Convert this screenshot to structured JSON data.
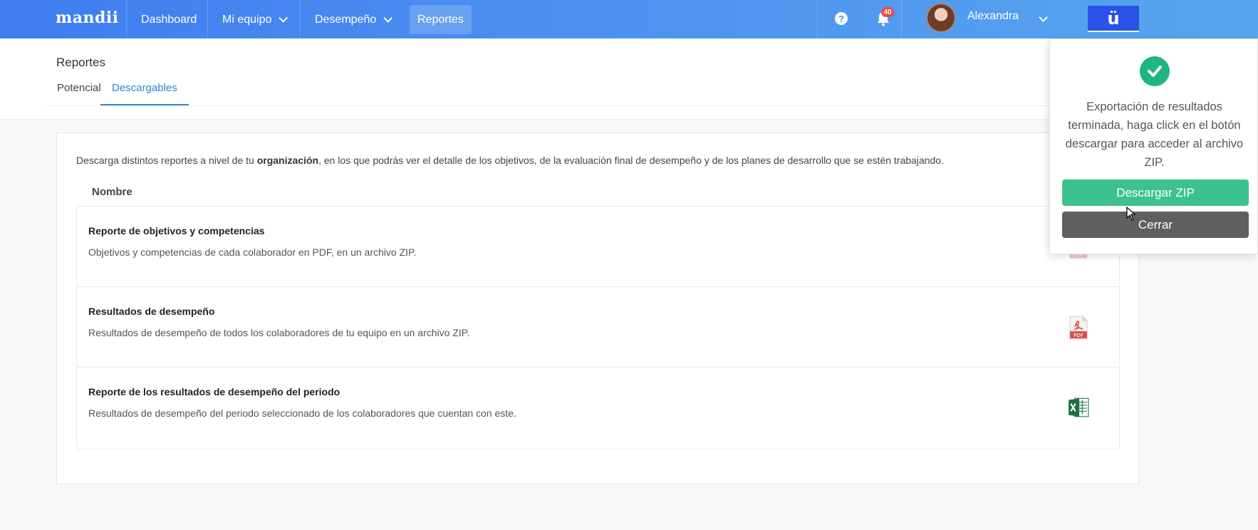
{
  "nav": {
    "logo": "mandii",
    "items": [
      {
        "label": "Dashboard",
        "has_dropdown": false,
        "active": false
      },
      {
        "label": "Mi equipo",
        "has_dropdown": true,
        "active": false
      },
      {
        "label": "Desempeño",
        "has_dropdown": true,
        "active": false
      },
      {
        "label": "Reportes",
        "has_dropdown": false,
        "active": true
      }
    ],
    "help_glyph": "?",
    "notifications_count": "40",
    "user_name": "Alexandra",
    "brand_glyph": "ü"
  },
  "header": {
    "title": "Reportes",
    "tabs": [
      {
        "label": "Potencial",
        "active": false
      },
      {
        "label": "Descargables",
        "active": true
      }
    ]
  },
  "content": {
    "intro_before": "Descarga distintos reportes a nivel de tu ",
    "intro_bold": "organización",
    "intro_after": ", en los que podrás ver el detalle de los objetivos, de la evaluación final de desempeño y de los planes de desarrollo que se estén trabajando.",
    "column_header": "Nombre",
    "reports": [
      {
        "title": "Reporte de objetivos y competencias",
        "description": "Objetivos y competencias de cada colaborador en PDF, en un archivo ZIP.",
        "icon": "pdf-icon"
      },
      {
        "title": "Resultados de desempeño",
        "description": "Resultados de desempeño de todos los colaboradores de tu equipo en un archivo ZIP.",
        "icon": "pdf-icon"
      },
      {
        "title": "Reporte de los resultados de desempeño del periodo",
        "description": "Resultados de desempeño del periodo seleccionado de los colaboradores que cuentan con este.",
        "icon": "excel-icon"
      }
    ]
  },
  "toast": {
    "message": "Exportación de resultados terminada, haga click en el botón descargar para acceder al archivo ZIP.",
    "download_label": "Descargar ZIP",
    "close_label": "Cerrar",
    "success_color": "#1fb584"
  },
  "colors": {
    "primary": "#3f7df0",
    "accent_tab": "#2a86d8",
    "download_button": "#3cc28f",
    "close_button": "#5f5f5f"
  }
}
